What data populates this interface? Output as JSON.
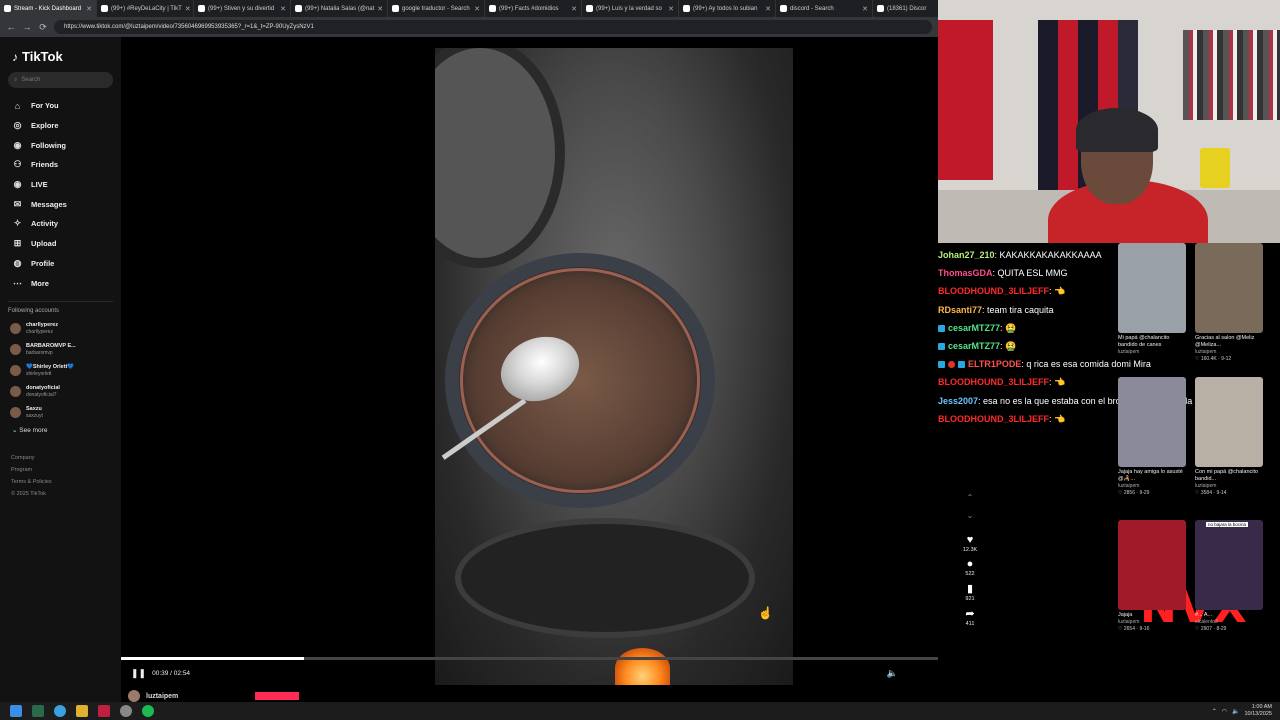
{
  "browser": {
    "tabs": [
      {
        "label": "Stream - Kick Dashboard",
        "active": true
      },
      {
        "label": "(99+) #ReyDeLaCity | TikT",
        "active": false
      },
      {
        "label": "(99+) Stiven y su divertid",
        "active": false
      },
      {
        "label": "(99+) Natalia Salas (@nat",
        "active": false
      },
      {
        "label": "google traductor - Search",
        "active": false
      },
      {
        "label": "(99+) Facts #domidios",
        "active": false
      },
      {
        "label": "(99+) Luis y la verdad so",
        "active": false
      },
      {
        "label": "(99+) Ay todos lo subian",
        "active": false
      },
      {
        "label": "discord - Search",
        "active": false
      },
      {
        "label": "(18361) Discor",
        "active": false
      }
    ],
    "url": "https://www.tiktok.com/@luztaipem/video/7356046969953935365?_r=1&_t=ZP-90UyZysNzV1"
  },
  "sidebar": {
    "logo": "TikTok",
    "search_placeholder": "Search",
    "menu": [
      {
        "icon": "home-icon",
        "glyph": "⌂",
        "label": "For You"
      },
      {
        "icon": "compass-icon",
        "glyph": "◎",
        "label": "Explore"
      },
      {
        "icon": "following-icon",
        "glyph": "◉",
        "label": "Following"
      },
      {
        "icon": "friends-icon",
        "glyph": "⚇",
        "label": "Friends"
      },
      {
        "icon": "live-icon",
        "glyph": "◉",
        "label": "LIVE"
      },
      {
        "icon": "messages-icon",
        "glyph": "✉",
        "label": "Messages"
      },
      {
        "icon": "activity-icon",
        "glyph": "✧",
        "label": "Activity"
      },
      {
        "icon": "upload-icon",
        "glyph": "⊞",
        "label": "Upload"
      },
      {
        "icon": "profile-icon",
        "glyph": "◍",
        "label": "Profile"
      },
      {
        "icon": "more-icon",
        "glyph": "⋯",
        "label": "More"
      }
    ],
    "following_title": "Following accounts",
    "accounts": [
      {
        "name": "charllyperez",
        "handle": "charllyperez"
      },
      {
        "name": "BARBAROMVP E...",
        "handle": "barbaromvp"
      },
      {
        "name": "💙Shirley Orlett💙",
        "handle": "shirleyorlett"
      },
      {
        "name": "donatyoficial",
        "handle": "donatyoficial7"
      },
      {
        "name": "Saxzu",
        "handle": "saxzuyt"
      }
    ],
    "see_more": "See more",
    "footer": [
      "Company",
      "Program",
      "Terms & Policies",
      "© 2025 TikTok"
    ]
  },
  "player": {
    "time": "00:39 / 02:54",
    "progress": 0.224,
    "author": "luztaipem",
    "likes": "12.3K",
    "comments": "522",
    "saves": "921",
    "shares": "411"
  },
  "chat": [
    {
      "user": "Johan27_210",
      "color": "#b7f07a",
      "msg": ": KAKAKKAKAKAKKAAAA",
      "badge": ""
    },
    {
      "user": "ThomasGDA",
      "color": "#ff4f8a",
      "msg": ": QUITA ESL MMG",
      "badge": ""
    },
    {
      "user": "BLOODHOUND_3LILJEFF",
      "color": "#ff2a2a",
      "msg": ": 👈",
      "badge": ""
    },
    {
      "user": "RDsanti77",
      "color": "#ffb84a",
      "msg": ": team tira caquita",
      "badge": ""
    },
    {
      "user": "cesarMTZ77",
      "color": "#52e38a",
      "msg": ": 🤮",
      "badge": "b"
    },
    {
      "user": "cesarMTZ77",
      "color": "#52e38a",
      "msg": ": 🤮",
      "badge": "b"
    },
    {
      "user": "ELTR1PODE",
      "color": "#ff5050",
      "msg": ": q rica es esa comida domi Mira",
      "badge": "br"
    },
    {
      "user": "BLOODHOUND_3LILJEFF",
      "color": "#ff2a2a",
      "msg": ": 👈",
      "badge": ""
    },
    {
      "user": "Jess2007",
      "color": "#6fc3ff",
      "msg": ": esa no es la que estaba con el bro enante en batalla 😂😂",
      "badge": ""
    },
    {
      "user": "BLOODHOUND_3LILJEFF",
      "color": "#ff2a2a",
      "msg": ": 👈",
      "badge": ""
    }
  ],
  "thumbs": [
    {
      "cap": "Mi papá @chalancito bandido de canes",
      "author": "luztaipem",
      "stats": "",
      "color": "#9aa0a8"
    },
    {
      "cap": "Gracias al salon @Meliz @Meliza...",
      "author": "luztaipem",
      "stats": "♡ 160.4K · 9-12",
      "color": "#7a6a5a"
    },
    {
      "cap": "Jajaja hay amiga lo asusté @🦂...",
      "author": "luztaipem",
      "stats": "♡ 2856 · 9-29",
      "color": "#8a8a9a"
    },
    {
      "cap": "Con mi papá @chalancito bandid...",
      "author": "luztaipem",
      "stats": "♡ 3584 · 9-14",
      "color": "#b8b0a4"
    },
    {
      "cap": "Jajaja",
      "author": "luztaipem",
      "stats": "♡ 2654 · 9-16",
      "color": "#a01a2a"
    },
    {
      "cap": "#... A...",
      "author": "elcalento3",
      "stats": "♡ 2907 · 8-29",
      "color": "#3a2a4a"
    }
  ],
  "thumb_tag": "no bajara la bocina",
  "overlay_text": "NVX",
  "taskbar": {
    "time": "1:00 AM",
    "date": "10/13/2025"
  }
}
